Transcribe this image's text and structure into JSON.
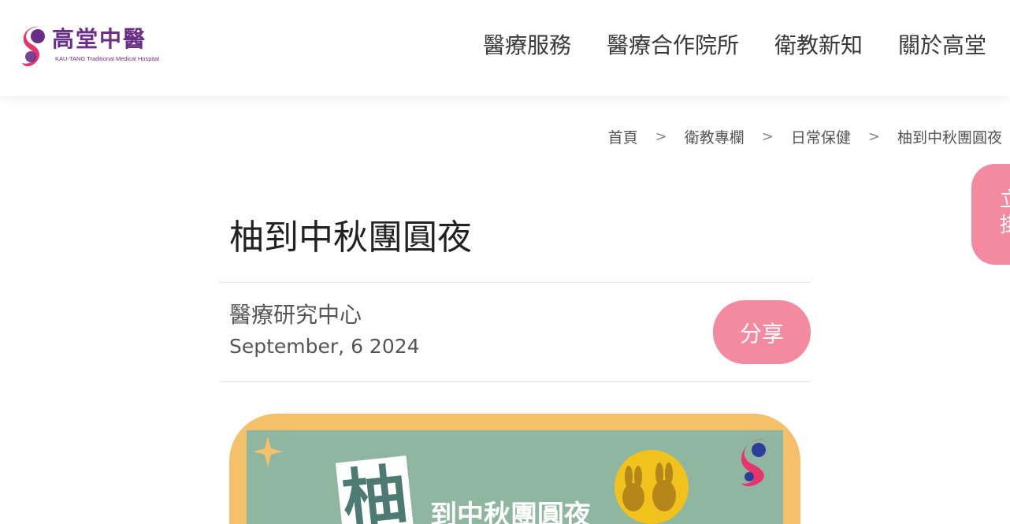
{
  "header": {
    "logo": {
      "name_cn": "高堂中醫",
      "name_en": "KAU-TANG Traditional Medical Hospital"
    },
    "nav": [
      {
        "label": "醫療服務"
      },
      {
        "label": "醫療合作院所"
      },
      {
        "label": "衛教新知"
      },
      {
        "label": "關於高堂"
      }
    ]
  },
  "breadcrumb": [
    {
      "label": "首頁"
    },
    {
      "label": "衛教專欄"
    },
    {
      "label": "日常保健"
    },
    {
      "label": "柚到中秋團圓夜"
    }
  ],
  "breadcrumb_separator": ">",
  "side_button": {
    "line1": "立",
    "line2": "掛"
  },
  "article": {
    "title": "柚到中秋團圓夜",
    "author": "醫療研究中心",
    "date": "September, 6 2024",
    "share_label": "分享",
    "banner": {
      "big_char": "柚",
      "subtitle": "到中秋團圓夜"
    }
  },
  "colors": {
    "accent_pink": "#f48aa0",
    "brand_purple": "#6a2e86",
    "banner_orange": "#f4c06a",
    "banner_green": "#8fb6a1"
  }
}
